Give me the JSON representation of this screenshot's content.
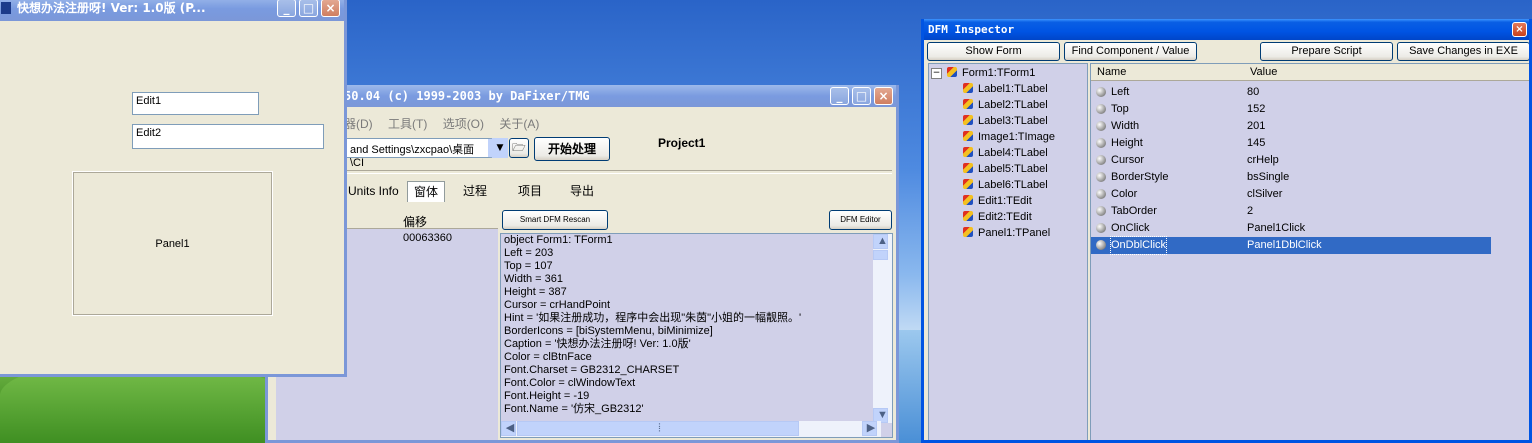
{
  "colors": {
    "title_active": "#0054e3",
    "title_inactive": "#7b97d8",
    "face": "#ece9d8",
    "memo_bg": "#d0d0e8",
    "selection": "#316ac5"
  },
  "form1": {
    "title": "快想办法注册呀!   Ver: 1.0版 (P...",
    "edit1": "Edit1",
    "edit2": "Edit2",
    "panel": "Panel1"
  },
  "dede": {
    "title": "50.04 (c) 1999-2003 by DaFixer/TMG",
    "menu": [
      "器(D)",
      "工具(T)",
      "选项(O)",
      "关于(A)"
    ],
    "path_value": "and Settings\\zxcpao\\桌面\\CI",
    "start_button": "开始处理",
    "project_label": "Project1",
    "tabs": [
      "Units Info",
      "窗体",
      "过程",
      "项目",
      "导出"
    ],
    "list_header_offset": "偏移",
    "list_value": "00063360",
    "smart_rescan": "Smart DFM Rescan",
    "dfm_editor": "DFM Editor",
    "memo_lines": [
      "object Form1: TForm1",
      "  Left = 203",
      "  Top = 107",
      "  Width = 361",
      "  Height = 387",
      "  Cursor = crHandPoint",
      "  Hint = '如果注册成功，程序中会出现\"朱茵\"小姐的一幅靓照。'",
      "  BorderIcons = [biSystemMenu, biMinimize]",
      "  Caption = '快想办法注册呀!   Ver: 1.0版'",
      "  Color = clBtnFace",
      "  Font.Charset = GB2312_CHARSET",
      "  Font.Color = clWindowText",
      "  Font.Height = -19",
      "  Font.Name = '仿宋_GB2312'"
    ]
  },
  "inspector": {
    "title": "DFM Inspector",
    "buttons": [
      "Show Form",
      "Find Component / Value",
      "Prepare Script",
      "Save Changes in EXE"
    ],
    "tree_root": "Form1:TForm1",
    "tree_items": [
      "Label1:TLabel",
      "Label2:TLabel",
      "Label3:TLabel",
      "Image1:TImage",
      "Label4:TLabel",
      "Label5:TLabel",
      "Label6:TLabel",
      "Edit1:TEdit",
      "Edit2:TEdit",
      "Panel1:TPanel"
    ],
    "col_name": "Name",
    "col_value": "Value",
    "props": [
      {
        "name": "Left",
        "value": "80"
      },
      {
        "name": "Top",
        "value": "152"
      },
      {
        "name": "Width",
        "value": "201"
      },
      {
        "name": "Height",
        "value": "145"
      },
      {
        "name": "Cursor",
        "value": "crHelp"
      },
      {
        "name": "BorderStyle",
        "value": "bsSingle"
      },
      {
        "name": "Color",
        "value": "clSilver"
      },
      {
        "name": "TabOrder",
        "value": "2"
      },
      {
        "name": "OnClick",
        "value": "Panel1Click"
      },
      {
        "name": "OnDblClick",
        "value": "Panel1DblClick"
      }
    ]
  }
}
